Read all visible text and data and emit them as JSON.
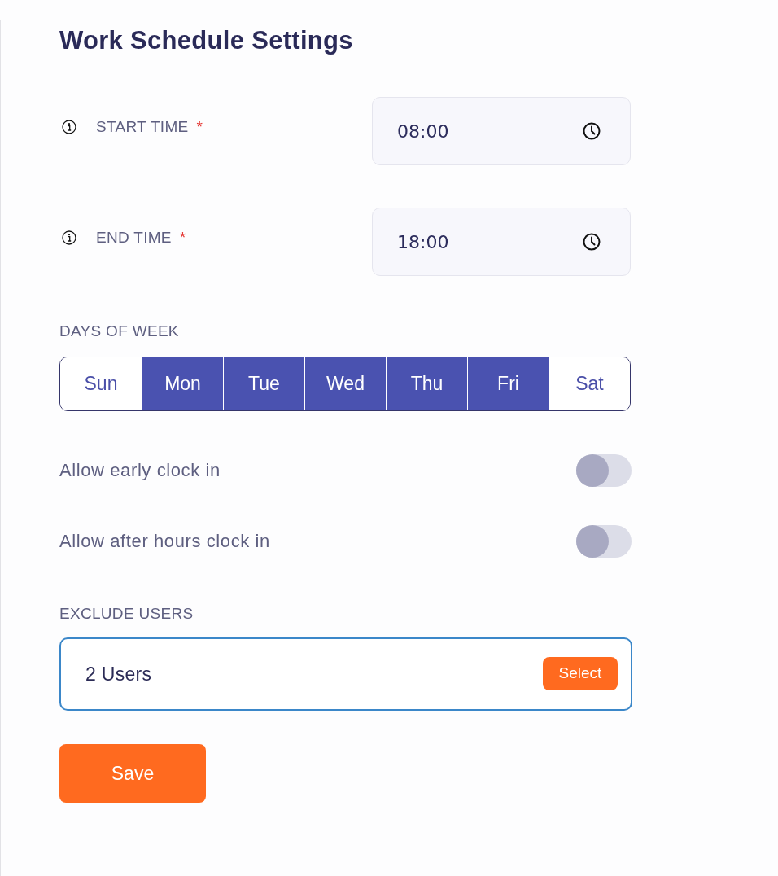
{
  "heading": "Work Schedule Settings",
  "time_fields": [
    {
      "label": "START TIME",
      "required_mark": "*",
      "value": "08:00"
    },
    {
      "label": "END TIME",
      "required_mark": "*",
      "value": "18:00"
    }
  ],
  "days": {
    "label": "DAYS OF WEEK",
    "items": [
      {
        "label": "Sun",
        "selected": false
      },
      {
        "label": "Mon",
        "selected": true
      },
      {
        "label": "Tue",
        "selected": true
      },
      {
        "label": "Wed",
        "selected": true
      },
      {
        "label": "Thu",
        "selected": true
      },
      {
        "label": "Fri",
        "selected": true
      },
      {
        "label": "Sat",
        "selected": false
      }
    ]
  },
  "toggles": [
    {
      "label": "Allow early clock in",
      "on": false
    },
    {
      "label": "Allow after hours clock in",
      "on": false
    }
  ],
  "exclude_users": {
    "label": "EXCLUDE USERS",
    "value": "2 Users",
    "button": "Select"
  },
  "save_button": "Save"
}
